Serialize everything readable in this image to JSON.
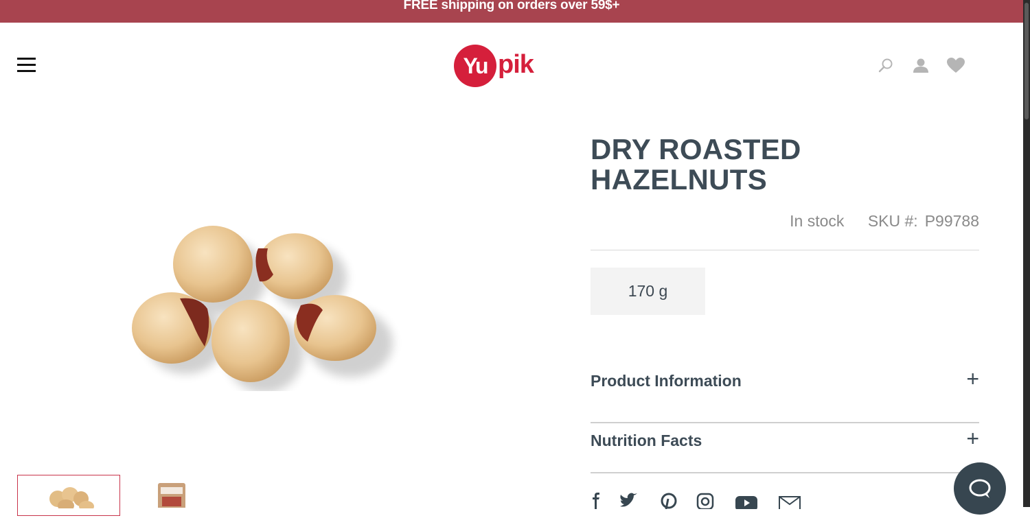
{
  "banner": {
    "text": "FREE shipping on orders over 59$+"
  },
  "header": {
    "logo": {
      "circle_text": "Yu",
      "text": "pik"
    },
    "icons": [
      "menu-icon",
      "search-icon",
      "user-icon",
      "heart-icon"
    ]
  },
  "product": {
    "title_line1": "DRY ROASTED",
    "title_line2": "HAZELNUTS",
    "stock": "In stock",
    "sku_label": "SKU #:",
    "sku_value": "P99788",
    "size_option": "170 g",
    "accordions": [
      {
        "label": "Product Information",
        "icon": "+"
      },
      {
        "label": "Nutrition Facts",
        "icon": "+"
      }
    ]
  },
  "social": [
    "facebook-icon",
    "twitter-icon",
    "pinterest-icon",
    "instagram-icon",
    "youtube-icon",
    "email-icon"
  ],
  "colors": {
    "brand_red": "#d51f3b",
    "banner": "#a8444f",
    "text_dark": "#3d4b56",
    "chat": "#374650"
  }
}
